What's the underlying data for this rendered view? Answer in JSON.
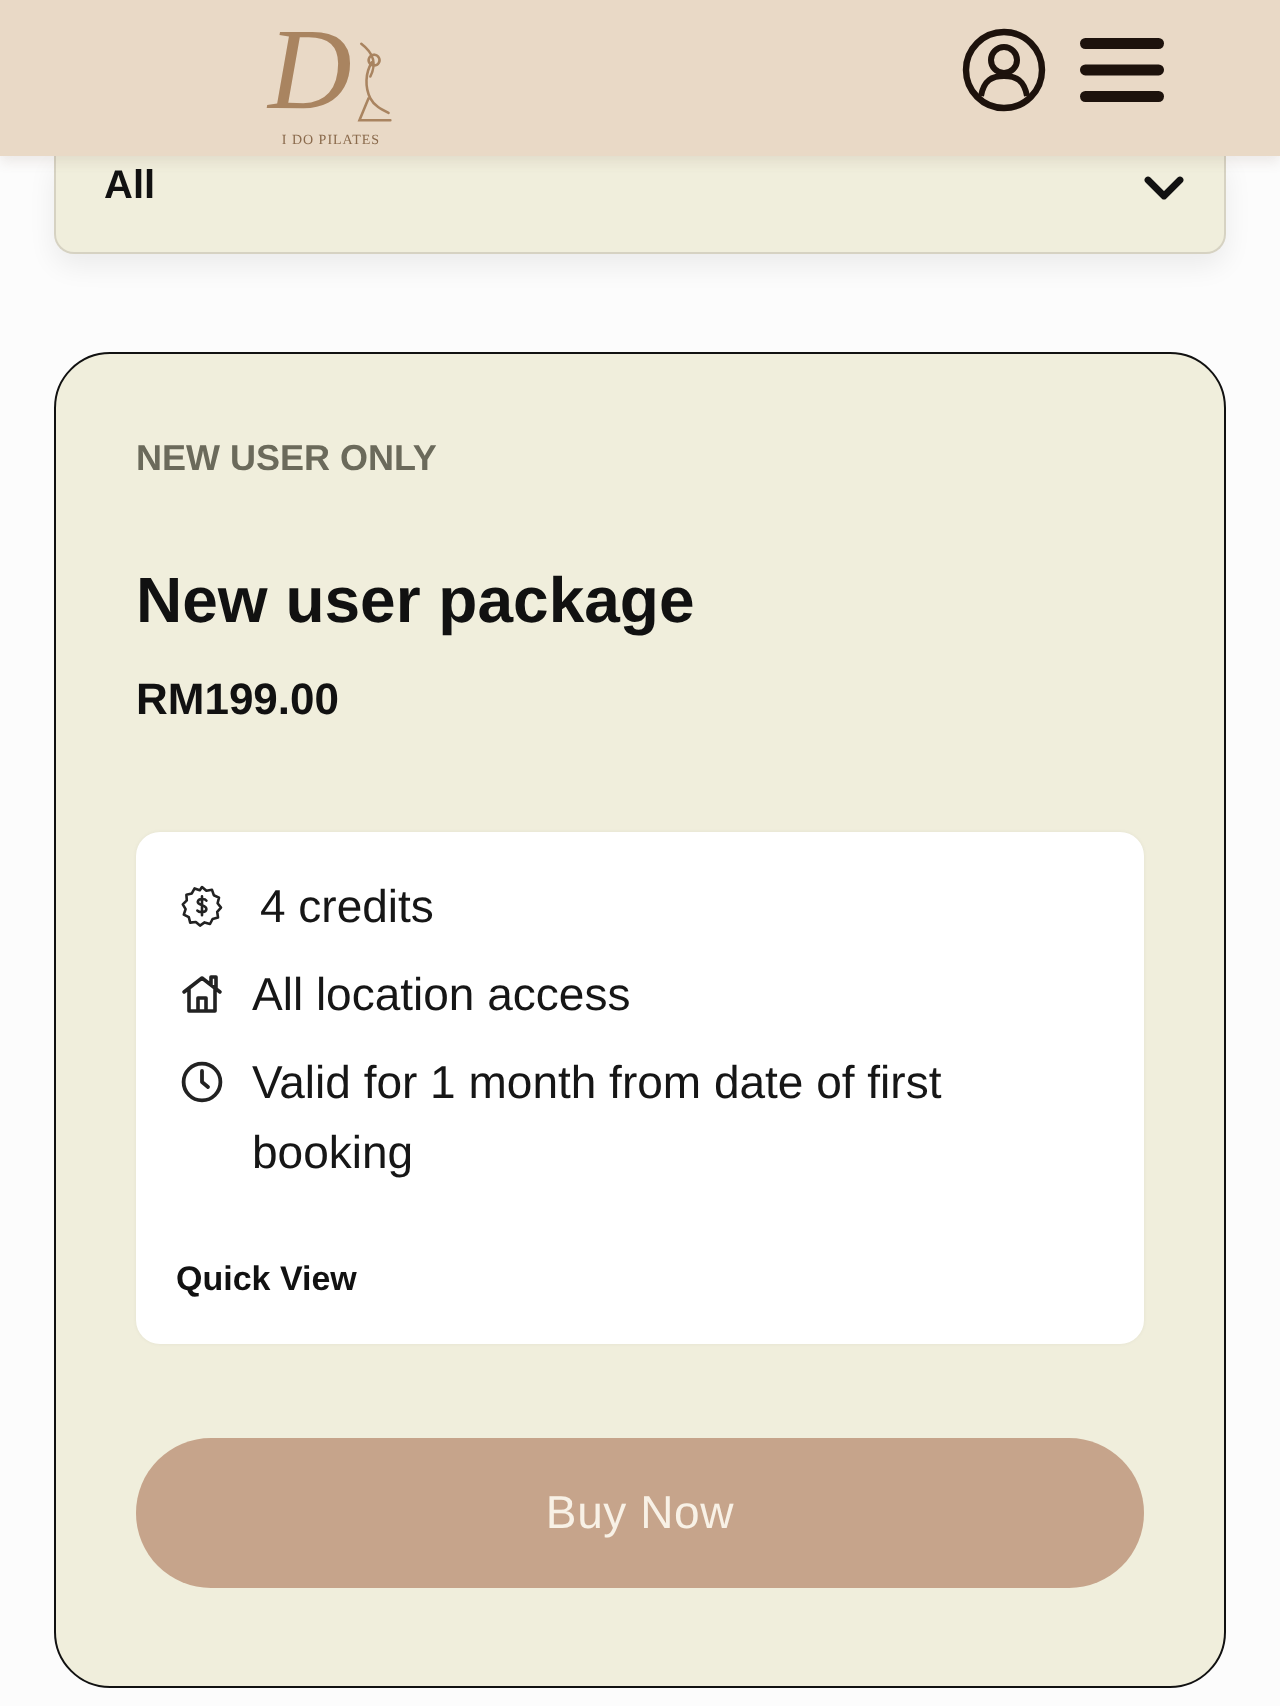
{
  "header": {
    "logo": {
      "monogram": "D",
      "wordmark": "I DO PILATES"
    }
  },
  "filter": {
    "value": "All"
  },
  "package": {
    "tag": "NEW USER ONLY",
    "title": "New user package",
    "price": "RM199.00",
    "features": [
      {
        "kind": "credits",
        "text": "4 credits"
      },
      {
        "kind": "location",
        "text": "All location access"
      },
      {
        "kind": "validity",
        "text": "Valid for 1 month from date of first booking"
      }
    ],
    "link": "Quick View",
    "button": "Buy Now"
  }
}
